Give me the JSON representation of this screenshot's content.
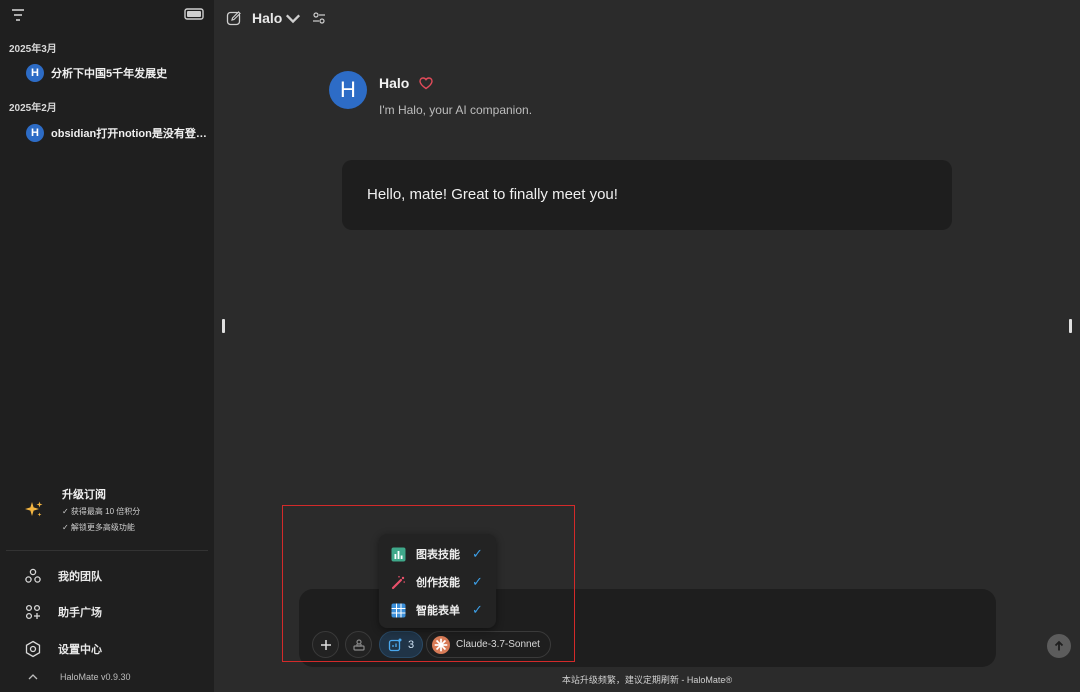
{
  "sidebar": {
    "sections": [
      {
        "date": "2025年3月",
        "items": [
          {
            "avatar": "H",
            "title": "分析下中国5千年发展史"
          }
        ]
      },
      {
        "date": "2025年2月",
        "items": [
          {
            "avatar": "H",
            "title": "obsidian打开notion是没有登录账号的情况下吗"
          }
        ]
      }
    ],
    "upgrade": {
      "title": "升级订阅",
      "line1": "✓ 获得最高 10 倍积分",
      "line2": "✓ 解锁更多高级功能"
    },
    "nav": [
      {
        "label": "我的团队",
        "icon": "team-icon"
      },
      {
        "label": "助手广场",
        "icon": "apps-grid-icon"
      },
      {
        "label": "设置中心",
        "icon": "settings-icon"
      }
    ],
    "version": "HaloMate v0.9.30"
  },
  "topbar": {
    "agent_name": "Halo"
  },
  "agent": {
    "avatar": "H",
    "name": "Halo",
    "description": "I'm Halo, your AI companion."
  },
  "greeting": "Hello, mate! Great to finally meet you!",
  "composer": {
    "skills_count": "3",
    "model": "Claude-3.7-Sonnet"
  },
  "skills_menu": [
    {
      "label": "图表技能",
      "icon": "chart-icon",
      "checked": true
    },
    {
      "label": "创作技能",
      "icon": "magic-wand-icon",
      "checked": true
    },
    {
      "label": "智能表单",
      "icon": "table-icon",
      "checked": true
    }
  ],
  "footer": "本站升级频繁，建议定期刷新 - HaloMate®",
  "colors": {
    "accent": "#3da0e8",
    "avatar": "#2d6cc6",
    "highlight": "#d32a2a",
    "heart": "#e24b5a"
  }
}
